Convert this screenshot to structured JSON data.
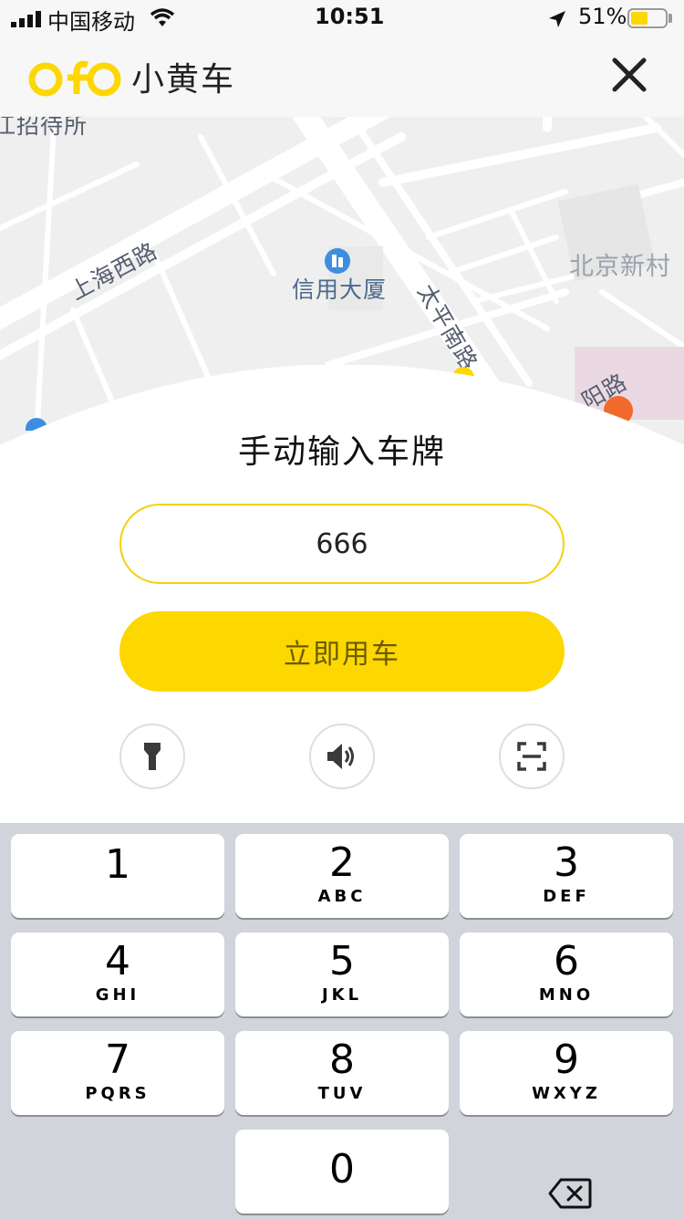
{
  "status_bar": {
    "carrier": "中国移动",
    "time": "10:51",
    "battery": "51%",
    "battery_level": 0.51
  },
  "header": {
    "logo_text": "ofo",
    "brand": "小黄车"
  },
  "map": {
    "labels": {
      "top_cut": "江招待所",
      "road_shanghai": "上海西路",
      "building": "信用大厦",
      "road_taiping": "太平南路",
      "village": "北京新村",
      "road_cut": "阳路"
    }
  },
  "panel": {
    "title": "手动输入车牌",
    "plate_value": "666",
    "submit_label": "立即用车"
  },
  "tools": [
    "flashlight-icon",
    "speaker-icon",
    "scan-icon"
  ],
  "keypad": {
    "keys": [
      {
        "digit": "1",
        "letters": ""
      },
      {
        "digit": "2",
        "letters": "ABC"
      },
      {
        "digit": "3",
        "letters": "DEF"
      },
      {
        "digit": "4",
        "letters": "GHI"
      },
      {
        "digit": "5",
        "letters": "JKL"
      },
      {
        "digit": "6",
        "letters": "MNO"
      },
      {
        "digit": "7",
        "letters": "PQRS"
      },
      {
        "digit": "8",
        "letters": "TUV"
      },
      {
        "digit": "9",
        "letters": "WXYZ"
      },
      {
        "digit": "0",
        "letters": ""
      }
    ]
  },
  "colors": {
    "brand_yellow": "#fdd700",
    "input_border": "#f5cf0a",
    "pin_orange": "#f16a2c"
  }
}
